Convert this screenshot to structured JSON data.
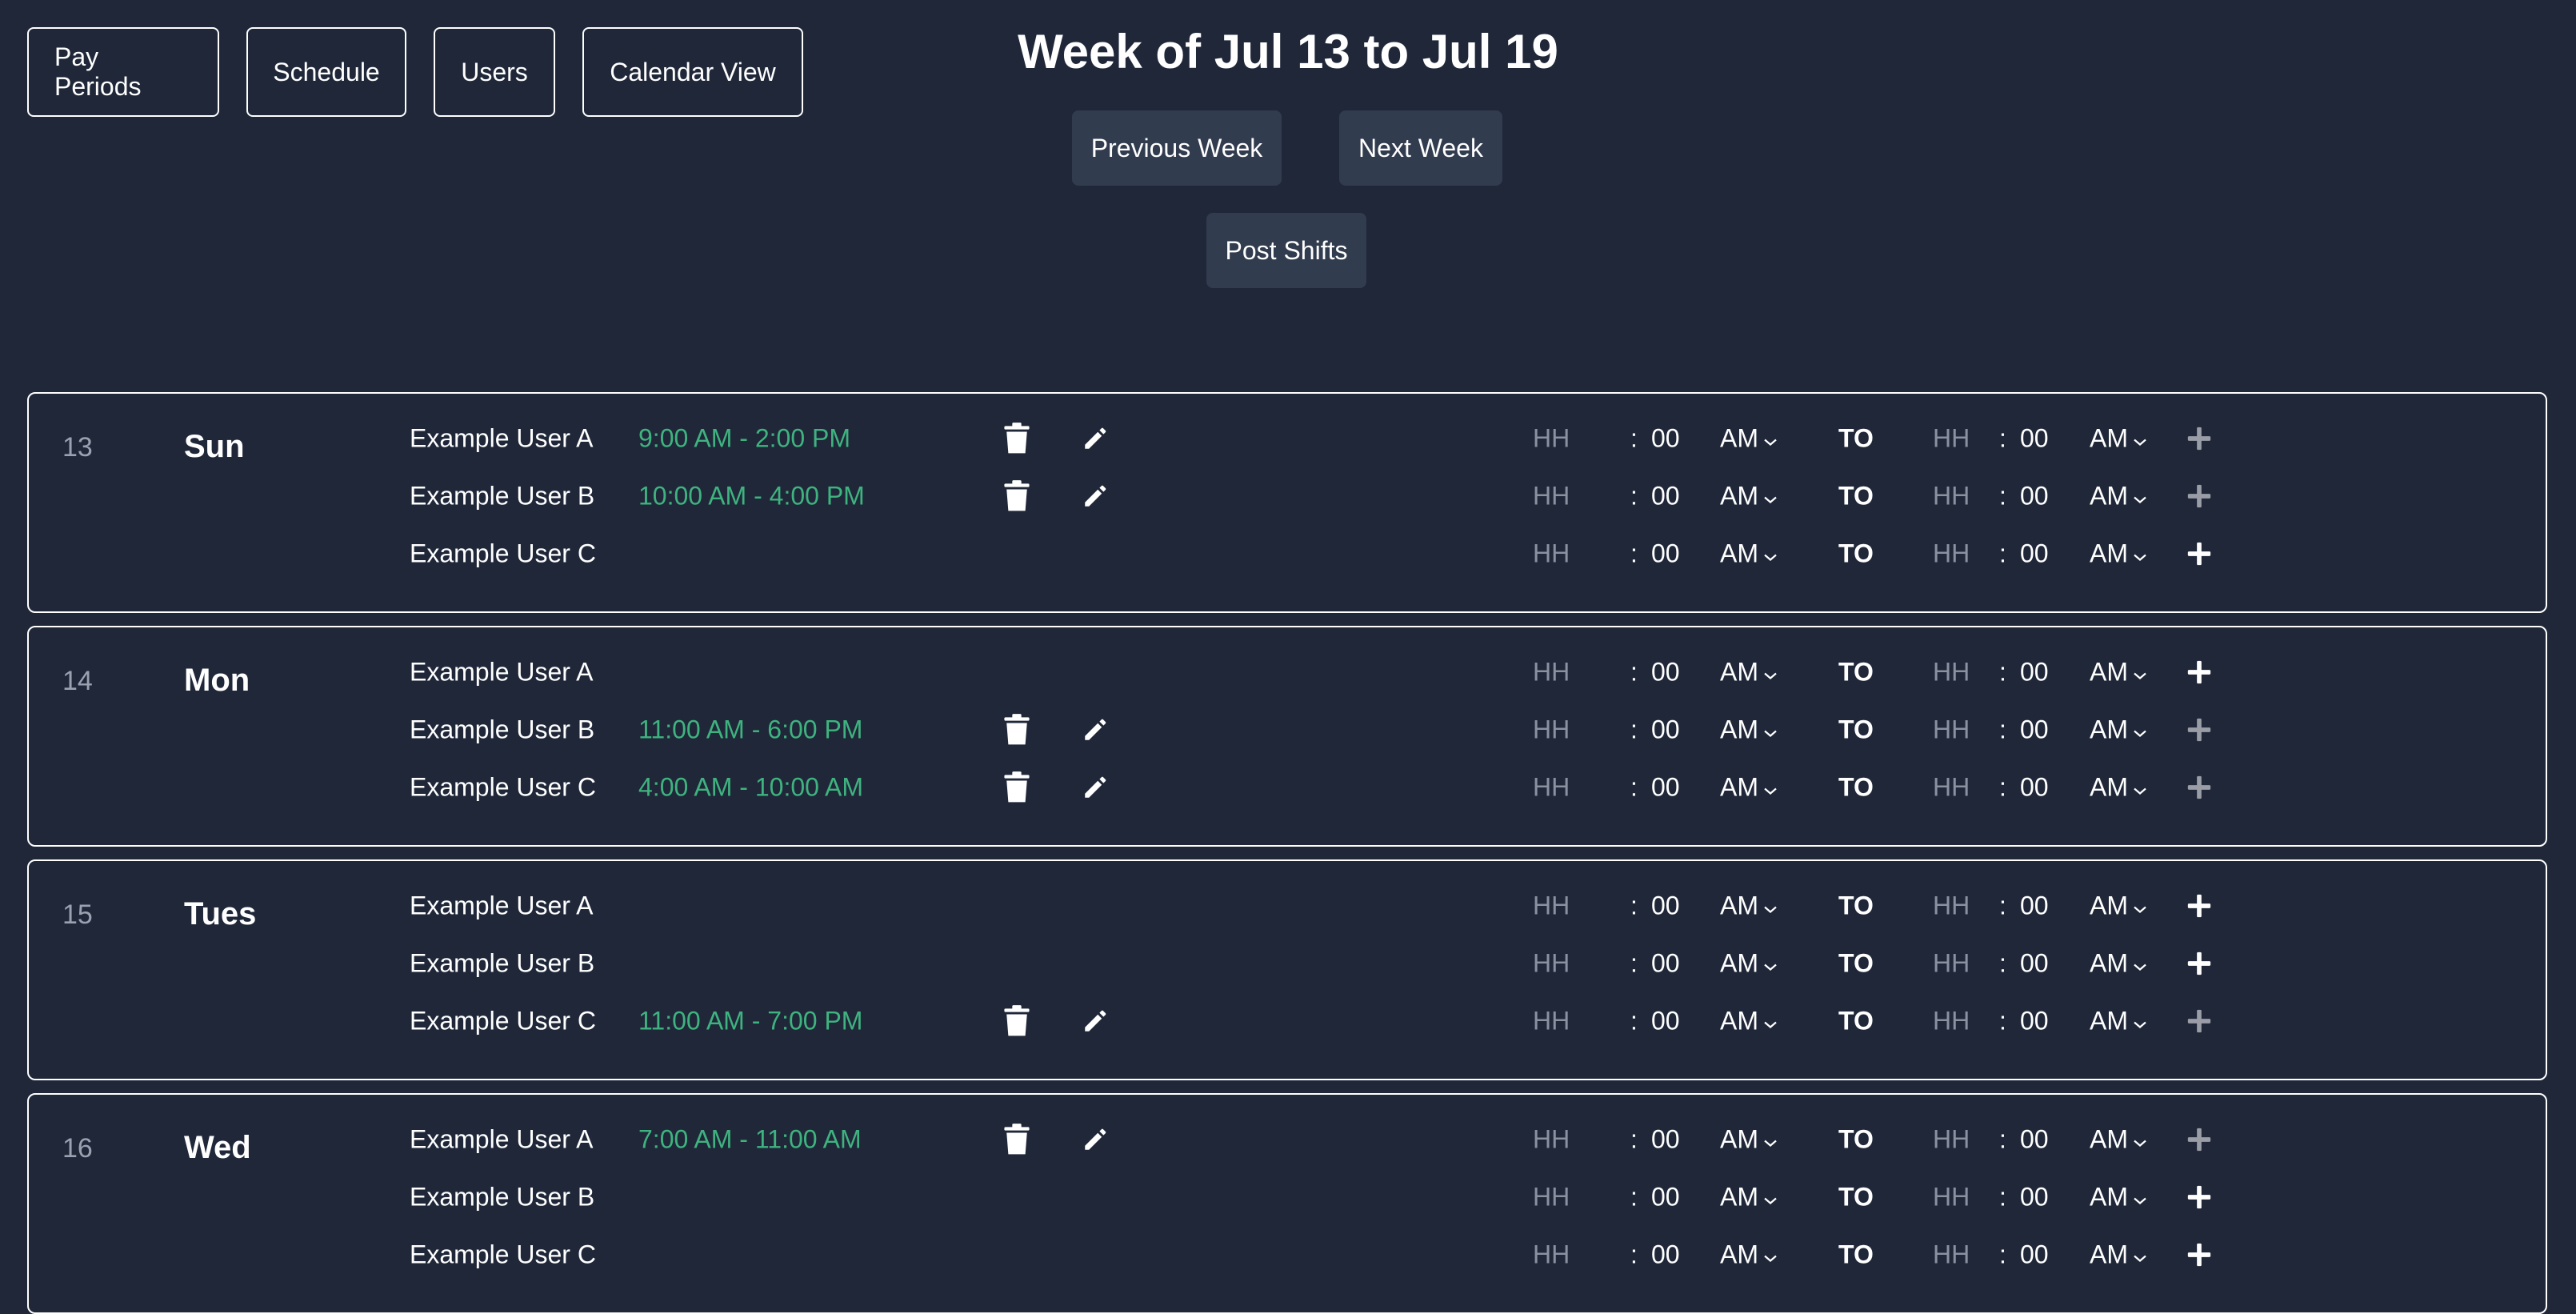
{
  "nav": {
    "pay_periods": "Pay Periods",
    "schedule": "Schedule",
    "users": "Users",
    "calendar_view": "Calendar View"
  },
  "header": {
    "title": "Week of Jul 13 to Jul 19",
    "previous_week": "Previous Week",
    "next_week": "Next Week",
    "post_shifts": "Post Shifts"
  },
  "time_input": {
    "hour_placeholder": "HH",
    "colon": ":",
    "minutes": "00",
    "meridiem": "AM",
    "to_label": "TO"
  },
  "colors": {
    "background": "#1f2739",
    "shift_text": "#3fb37f",
    "button_bg": "#323c4f"
  },
  "days": [
    {
      "num": "13",
      "name": "Sun",
      "rows": [
        {
          "user": "Example User A",
          "shift": "9:00 AM - 2:00 PM"
        },
        {
          "user": "Example User B",
          "shift": "10:00 AM - 4:00 PM"
        },
        {
          "user": "Example User C",
          "shift": ""
        }
      ]
    },
    {
      "num": "14",
      "name": "Mon",
      "rows": [
        {
          "user": "Example User A",
          "shift": ""
        },
        {
          "user": "Example User B",
          "shift": "11:00 AM - 6:00 PM"
        },
        {
          "user": "Example User C",
          "shift": "4:00 AM - 10:00 AM"
        }
      ]
    },
    {
      "num": "15",
      "name": "Tues",
      "rows": [
        {
          "user": "Example User A",
          "shift": ""
        },
        {
          "user": "Example User B",
          "shift": ""
        },
        {
          "user": "Example User C",
          "shift": "11:00 AM - 7:00 PM"
        }
      ]
    },
    {
      "num": "16",
      "name": "Wed",
      "rows": [
        {
          "user": "Example User A",
          "shift": "7:00 AM - 11:00 AM"
        },
        {
          "user": "Example User B",
          "shift": ""
        },
        {
          "user": "Example User C",
          "shift": ""
        }
      ]
    }
  ]
}
